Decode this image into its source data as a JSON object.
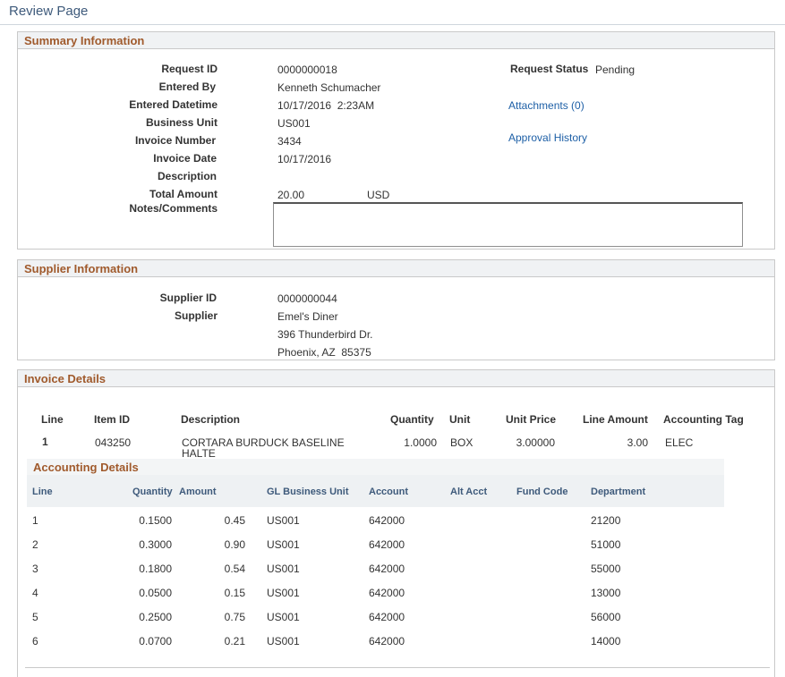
{
  "page": {
    "title": "Review Page"
  },
  "summary": {
    "section_title": "Summary Information",
    "request_id_label": "Request ID",
    "request_id": "0000000018",
    "entered_by_label": "Entered By",
    "entered_by": "Kenneth Schumacher",
    "entered_datetime_label": "Entered Datetime",
    "entered_datetime": "10/17/2016  2:23AM",
    "business_unit_label": "Business Unit",
    "business_unit": "US001",
    "invoice_number_label": "Invoice Number",
    "invoice_number": "3434",
    "invoice_date_label": "Invoice Date",
    "invoice_date": "10/17/2016",
    "description_label": "Description",
    "total_amount_label": "Total Amount",
    "total_amount": "20.00",
    "currency": "USD",
    "notes_label": "Notes/Comments",
    "notes_value": "",
    "request_status_label": "Request Status",
    "request_status": "Pending",
    "attachments_link": "Attachments (0)",
    "approval_history_link": "Approval History"
  },
  "supplier": {
    "section_title": "Supplier Information",
    "supplier_id_label": "Supplier ID",
    "supplier_id": "0000000044",
    "supplier_label": "Supplier",
    "supplier_name": "Emel's Diner",
    "address_line1": "396 Thunderbird Dr.",
    "address_line2": "Phoenix, AZ  85375"
  },
  "invoice": {
    "section_title": "Invoice Details",
    "headers": {
      "line": "Line",
      "item_id": "Item ID",
      "description": "Description",
      "quantity": "Quantity",
      "unit": "Unit",
      "unit_price": "Unit Price",
      "line_amount": "Line Amount",
      "accounting_tag": "Accounting Tag"
    },
    "row": {
      "line": "1",
      "item_id": "043250",
      "description_1": "CORTARA BURDUCK BASELINE",
      "description_2": "HALTE",
      "quantity": "1.0000",
      "unit": "BOX",
      "unit_price": "3.00000",
      "line_amount": "3.00",
      "accounting_tag": "ELEC"
    }
  },
  "accounting": {
    "title": "Accounting Details",
    "headers": {
      "line": "Line",
      "quantity": "Quantity",
      "amount": "Amount",
      "gl_business_unit": "GL Business Unit",
      "account": "Account",
      "alt_acct": "Alt Acct",
      "fund_code": "Fund Code",
      "department": "Department"
    },
    "rows": [
      {
        "line": "1",
        "quantity": "0.1500",
        "amount": "0.45",
        "gl_bu": "US001",
        "account": "642000",
        "department": "21200"
      },
      {
        "line": "2",
        "quantity": "0.3000",
        "amount": "0.90",
        "gl_bu": "US001",
        "account": "642000",
        "department": "51000"
      },
      {
        "line": "3",
        "quantity": "0.1800",
        "amount": "0.54",
        "gl_bu": "US001",
        "account": "642000",
        "department": "55000"
      },
      {
        "line": "4",
        "quantity": "0.0500",
        "amount": "0.15",
        "gl_bu": "US001",
        "account": "642000",
        "department": "13000"
      },
      {
        "line": "5",
        "quantity": "0.2500",
        "amount": "0.75",
        "gl_bu": "US001",
        "account": "642000",
        "department": "56000"
      },
      {
        "line": "6",
        "quantity": "0.0700",
        "amount": "0.21",
        "gl_bu": "US001",
        "account": "642000",
        "department": "14000"
      }
    ]
  },
  "colors": {
    "section_title": "#a05a2c",
    "link": "#1d5fa6",
    "accounting_header": "#3e5a7b"
  }
}
